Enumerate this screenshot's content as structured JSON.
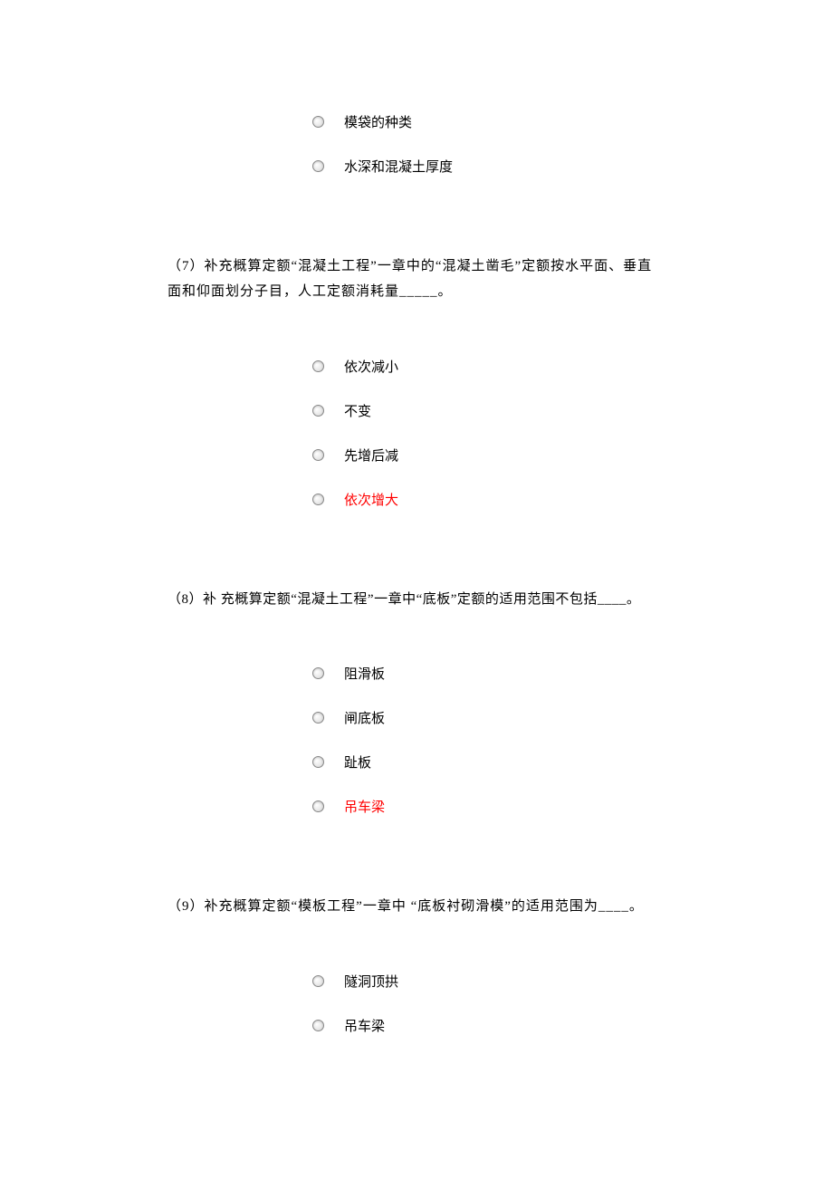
{
  "intro_options": [
    {
      "label": "模袋的种类",
      "highlight": false
    },
    {
      "label": "水深和混凝土厚度",
      "highlight": false
    }
  ],
  "questions": [
    {
      "number": "（7）",
      "text": "补充概算定额“混凝土工程”一章中的“混凝土凿毛”定额按水平面、垂直面和仰面划分子目，人工定额消耗量_____。",
      "options": [
        {
          "label": "依次减小",
          "highlight": false
        },
        {
          "label": "不变",
          "highlight": false
        },
        {
          "label": "先增后减",
          "highlight": false
        },
        {
          "label": "依次增大",
          "highlight": true
        }
      ]
    },
    {
      "number": "（8）",
      "text": "补 充概算定额“混凝土工程”一章中“底板”定额的适用范围不包括____。",
      "options": [
        {
          "label": "阻滑板",
          "highlight": false
        },
        {
          "label": "闸底板",
          "highlight": false
        },
        {
          "label": "趾板",
          "highlight": false
        },
        {
          "label": "吊车梁",
          "highlight": true
        }
      ]
    },
    {
      "number": "（9）",
      "text": "补充概算定额“模板工程”一章中 “底板衬砌滑模”的适用范围为____。",
      "options": [
        {
          "label": "隧洞顶拱",
          "highlight": false
        },
        {
          "label": "吊车梁",
          "highlight": false
        }
      ]
    }
  ]
}
